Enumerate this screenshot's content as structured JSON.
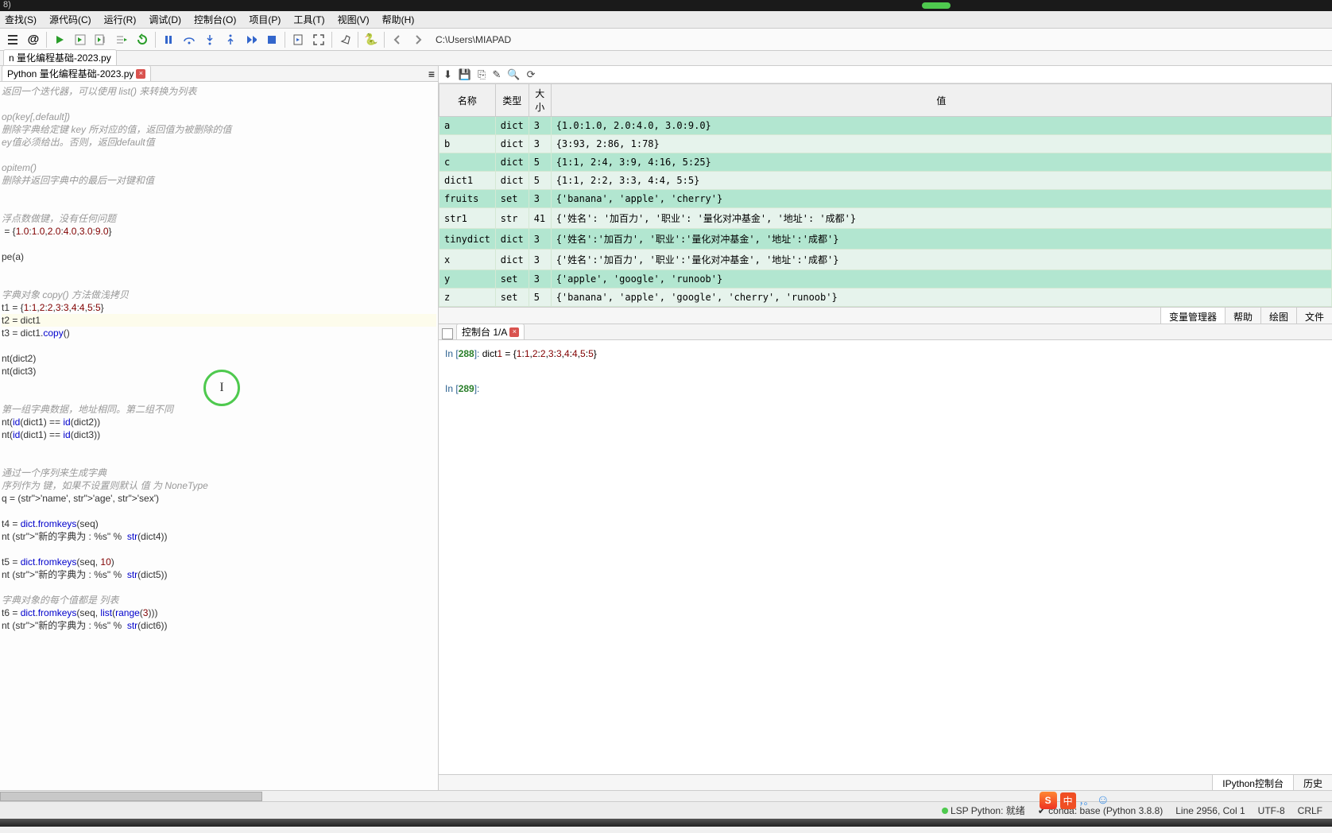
{
  "title_fragment": "8)",
  "menu": [
    "查找(S)",
    "源代码(C)",
    "运行(R)",
    "调试(D)",
    "控制台(O)",
    "项目(P)",
    "工具(T)",
    "视图(V)",
    "帮助(H)"
  ],
  "path": "C:\\Users\\MIAPAD",
  "file_tab": "n 量化编程基础-2023.py",
  "editor_tab": "Python 量化编程基础-2023.py",
  "code_lines": [
    {
      "cls": "comment",
      "t": "返回一个迭代器，可以使用 list() 来转换为列表"
    },
    {
      "cls": "",
      "t": ""
    },
    {
      "cls": "comment",
      "t": "op(key[,default])"
    },
    {
      "cls": "comment",
      "t": "删除字典给定键 key 所对应的值，返回值为被删除的值"
    },
    {
      "cls": "comment",
      "t": "ey值必须给出。否则，返回default值"
    },
    {
      "cls": "",
      "t": ""
    },
    {
      "cls": "comment",
      "t": "opitem()"
    },
    {
      "cls": "comment",
      "t": "删除并返回字典中的最后一对键和值"
    },
    {
      "cls": "",
      "t": ""
    },
    {
      "cls": "",
      "t": ""
    },
    {
      "cls": "comment",
      "t": "浮点数做键，没有任何问题"
    },
    {
      "cls": "code",
      "t": " = {1.0:1.0,2.0:4.0,3.0:9.0}"
    },
    {
      "cls": "",
      "t": ""
    },
    {
      "cls": "code",
      "t": "pe(a)"
    },
    {
      "cls": "",
      "t": ""
    },
    {
      "cls": "",
      "t": ""
    },
    {
      "cls": "comment",
      "t": "字典对象 copy() 方法做浅拷贝"
    },
    {
      "cls": "code",
      "t": "t1 = {1:1,2:2,3:3,4:4,5:5}"
    },
    {
      "cls": "code hl",
      "t": "t2 = dict1"
    },
    {
      "cls": "code",
      "t": "t3 = dict1.copy()"
    },
    {
      "cls": "",
      "t": ""
    },
    {
      "cls": "code",
      "t": "nt(dict2)"
    },
    {
      "cls": "code",
      "t": "nt(dict3)"
    },
    {
      "cls": "",
      "t": ""
    },
    {
      "cls": "",
      "t": ""
    },
    {
      "cls": "comment",
      "t": "第一组字典数据，地址相同。第二组不同"
    },
    {
      "cls": "code",
      "t": "nt(id(dict1) == id(dict2))"
    },
    {
      "cls": "code",
      "t": "nt(id(dict1) == id(dict3))"
    },
    {
      "cls": "",
      "t": ""
    },
    {
      "cls": "",
      "t": ""
    },
    {
      "cls": "comment",
      "t": "通过一个序列来生成字典"
    },
    {
      "cls": "comment",
      "t": "序列作为 键，如果不设置则默认 值 为 NoneType"
    },
    {
      "cls": "code",
      "t": "q = ('name', 'age', 'sex')"
    },
    {
      "cls": "",
      "t": ""
    },
    {
      "cls": "code",
      "t": "t4 = dict.fromkeys(seq)"
    },
    {
      "cls": "code",
      "t": "nt (\"新的字典为 : %s\" %  str(dict4))"
    },
    {
      "cls": "",
      "t": ""
    },
    {
      "cls": "code",
      "t": "t5 = dict.fromkeys(seq, 10)"
    },
    {
      "cls": "code",
      "t": "nt (\"新的字典为 : %s\" %  str(dict5))"
    },
    {
      "cls": "",
      "t": ""
    },
    {
      "cls": "comment",
      "t": "字典对象的每个值都是 列表"
    },
    {
      "cls": "code",
      "t": "t6 = dict.fromkeys(seq, list(range(3)))"
    },
    {
      "cls": "code",
      "t": "nt (\"新的字典为 : %s\" %  str(dict6))"
    }
  ],
  "var_header": [
    "名称",
    "类型",
    "大小",
    "值"
  ],
  "vars": [
    {
      "n": "a",
      "t": "dict",
      "s": "3",
      "v": "{1.0:1.0, 2.0:4.0, 3.0:9.0}"
    },
    {
      "n": "b",
      "t": "dict",
      "s": "3",
      "v": "{3:93, 2:86, 1:78}"
    },
    {
      "n": "c",
      "t": "dict",
      "s": "5",
      "v": "{1:1, 2:4, 3:9, 4:16, 5:25}"
    },
    {
      "n": "dict1",
      "t": "dict",
      "s": "5",
      "v": "{1:1, 2:2, 3:3, 4:4, 5:5}"
    },
    {
      "n": "fruits",
      "t": "set",
      "s": "3",
      "v": "{'banana', 'apple', 'cherry'}"
    },
    {
      "n": "str1",
      "t": "str",
      "s": "41",
      "v": "{'姓名': '加百力', '职业': '量化对冲基金', '地址': '成都'}"
    },
    {
      "n": "tinydict",
      "t": "dict",
      "s": "3",
      "v": "{'姓名':'加百力', '职业':'量化对冲基金', '地址':'成都'}"
    },
    {
      "n": "x",
      "t": "dict",
      "s": "3",
      "v": "{'姓名':'加百力', '职业':'量化对冲基金', '地址':'成都'}"
    },
    {
      "n": "y",
      "t": "set",
      "s": "3",
      "v": "{'apple', 'google', 'runoob'}"
    },
    {
      "n": "z",
      "t": "set",
      "s": "5",
      "v": "{'banana', 'apple', 'google', 'cherry', 'runoob'}"
    }
  ],
  "var_tabs": [
    "变量管理器",
    "帮助",
    "绘图",
    "文件"
  ],
  "console_tab": "控制台 1/A",
  "console_lines": [
    {
      "n": "288",
      "t": "dict1 = {1:1,2:2,3:3,4:4,5:5}"
    },
    {
      "n": "289",
      "t": ""
    }
  ],
  "console_bottom_tabs": [
    "IPython控制台",
    "历史"
  ],
  "status": {
    "lsp": "LSP Python: 就绪",
    "conda": "conda: base (Python 3.8.8)",
    "line": "Line 2956, Col 1",
    "enc": "UTF-8",
    "eol": "CRLF"
  },
  "ime": {
    "logo": "S",
    "lang": "中"
  }
}
